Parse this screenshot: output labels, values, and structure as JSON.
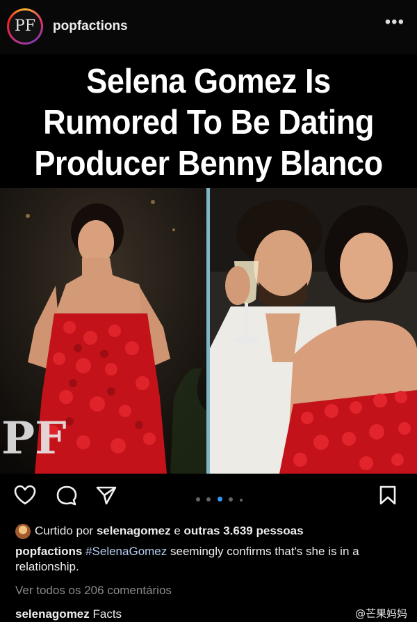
{
  "header": {
    "avatar_text": "PF",
    "username": "popfactions",
    "more_label": "•••"
  },
  "post": {
    "headline_lines": [
      "Selena Gomez Is",
      "Rumored To Be Dating",
      "Producer Benny Blanco"
    ],
    "watermark": "PF",
    "carousel": {
      "count": 5,
      "active_index": 2
    }
  },
  "likes": {
    "prefix": "Curtido por",
    "user": "selenagomez",
    "middle": "e",
    "others": "outras 3.639 pessoas"
  },
  "caption": {
    "user": "popfactions",
    "hashtag": "#SelenaGomez",
    "text": "seemingly confirms that's she is in a relationship."
  },
  "comments_link": "Ver todos os 206 comentários",
  "next_comment": {
    "user": "selenagomez",
    "text": "Facts"
  },
  "source_watermark": "@芒果妈妈",
  "icons": {
    "like": "heart-icon",
    "comment": "comment-icon",
    "share": "send-icon",
    "save": "bookmark-icon"
  }
}
